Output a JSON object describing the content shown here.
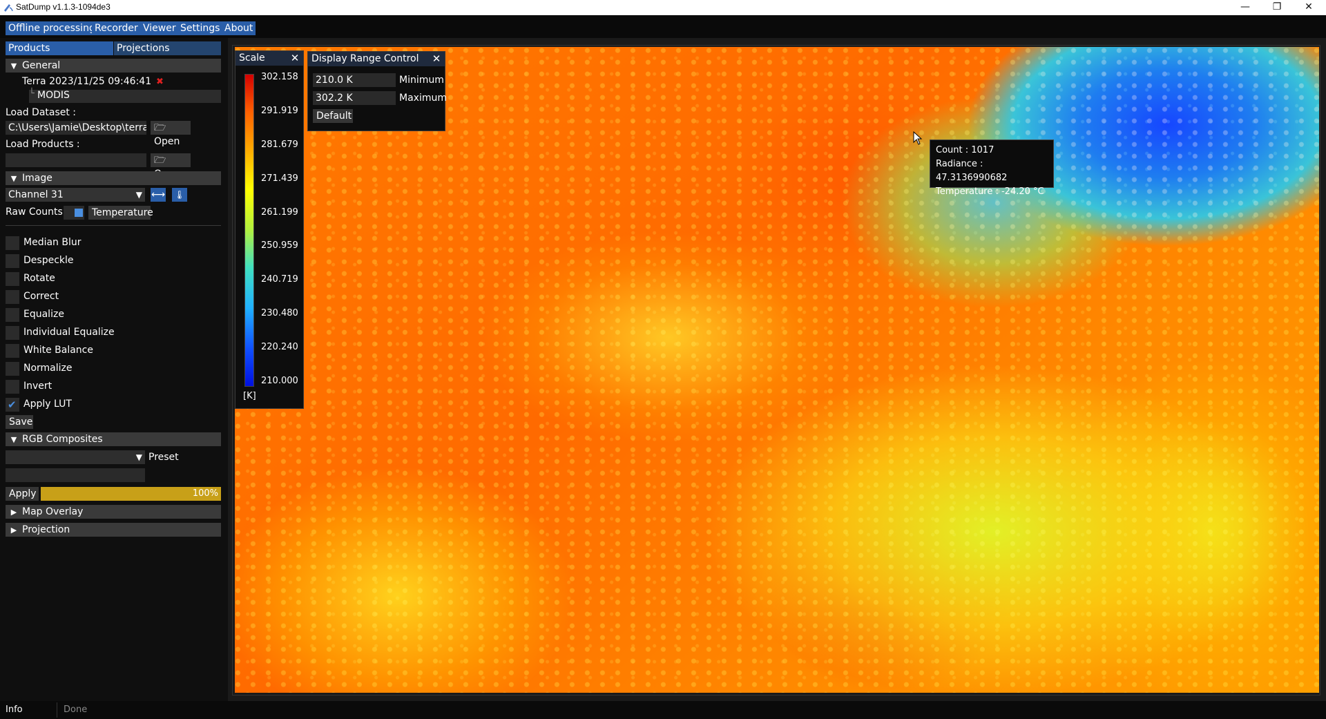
{
  "window": {
    "title": "SatDump v1.1.3-1094de3",
    "controls": [
      "—",
      "❐",
      "✕"
    ]
  },
  "menu": [
    "Offline processing",
    "Recorder",
    "Viewer",
    "Settings",
    "About"
  ],
  "sidebar": {
    "tabs": [
      "Products",
      "Projections"
    ],
    "general": {
      "header": "General",
      "dataset_label": "Terra 2023/11/25 09:46:41",
      "remove_glyph": "✖",
      "product": "MODIS",
      "load_dataset_label": "Load Dataset :",
      "load_dataset_path": "C:\\Users\\Jamie\\Desktop\\terra\\d",
      "open_label": "Open",
      "load_products_label": "Load Products :",
      "load_products_path": "",
      "open_label2": "Open"
    },
    "image": {
      "header": "Image",
      "channel": "Channel 31",
      "raw_counts": "Raw Counts",
      "temperature": "Temperature",
      "options": [
        {
          "label": "Median Blur",
          "checked": false
        },
        {
          "label": "Despeckle",
          "checked": false
        },
        {
          "label": "Rotate",
          "checked": false
        },
        {
          "label": "Correct",
          "checked": false
        },
        {
          "label": "Equalize",
          "checked": false
        },
        {
          "label": "Individual Equalize",
          "checked": false
        },
        {
          "label": "White Balance",
          "checked": false
        },
        {
          "label": "Normalize",
          "checked": false
        },
        {
          "label": "Invert",
          "checked": false
        },
        {
          "label": "Apply LUT",
          "checked": true
        }
      ],
      "save": "Save"
    },
    "rgb": {
      "header": "RGB Composites",
      "preset_label": "Preset",
      "preset_value": "",
      "expression": "",
      "apply": "Apply",
      "progress_text": "100%",
      "progress": 1.0
    },
    "map_overlay": "Map Overlay",
    "projection": "Projection"
  },
  "scale": {
    "title": "Scale",
    "ticks": [
      "302.158",
      "291.919",
      "281.679",
      "271.439",
      "261.199",
      "250.959",
      "240.719",
      "230.480",
      "220.240",
      "210.000"
    ],
    "unit": "[K]"
  },
  "display_range": {
    "title": "Display Range Control",
    "min_value": "210.0 K",
    "min_label": "Minimum",
    "max_value": "302.2 K",
    "max_label": "Maximum",
    "default": "Default"
  },
  "tooltip": {
    "count": "Count : 1017",
    "radiance": "Radiance : 47.3136990682",
    "temperature": "Temperature : -24.20 °C"
  },
  "status": {
    "tab": "Info",
    "message": "Done"
  },
  "colors": {
    "accent": "#2a5ea8",
    "section": "#3a3a3a",
    "progress": "#c8a018",
    "check": "#4a8fe0"
  }
}
